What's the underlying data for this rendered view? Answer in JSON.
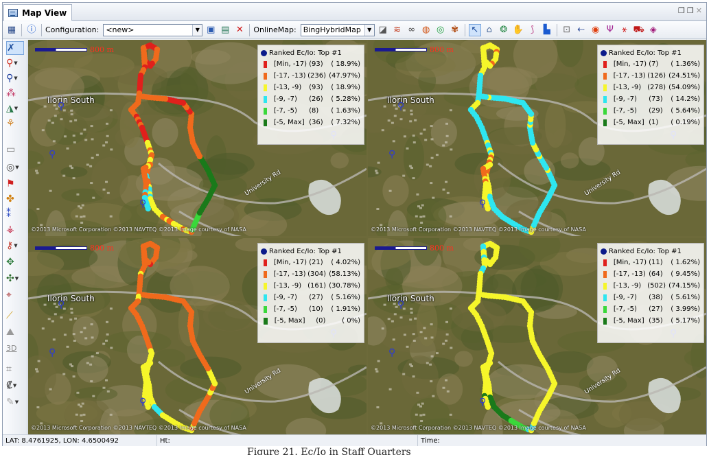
{
  "window": {
    "tab_label": "Map View"
  },
  "toolbar": {
    "configuration_label": "Configuration:",
    "configuration_value": "<new>",
    "onlinemap_label": "OnlineMap:",
    "onlinemap_value": "BingHybridMap"
  },
  "map": {
    "scale_text": "800 m",
    "town_label": "Ilorin South",
    "road_label": "University Rd",
    "credit_text": "©2013 Microsoft Corporation ©2013 NAVTEQ ©2013 Image courtesy of NASA",
    "legend_title": "Ranked Ec/Io: Top #1",
    "ranges": [
      "[Min, -17)",
      "[-17, -13)",
      "[-13, -9)",
      "[-9, -7)",
      "[-7, -5)",
      "[-5, Max]"
    ],
    "range_colors": [
      "#e0201c",
      "#f06a1c",
      "#f6f62a",
      "#2ee6f0",
      "#3ad83a",
      "#1a7a1a"
    ]
  },
  "panels": [
    {
      "counts": [
        "(93)",
        "(236)",
        "(93)",
        "(26)",
        "(8)",
        "(36)"
      ],
      "percents": [
        "( 18.9%)",
        "(47.97%)",
        "( 18.9%)",
        "( 5.28%)",
        "( 1.63%)",
        "( 7.32%)"
      ]
    },
    {
      "counts": [
        "(7)",
        "(126)",
        "(278)",
        "(73)",
        "(29)",
        "(1)"
      ],
      "percents": [
        "( 1.36%)",
        "(24.51%)",
        "(54.09%)",
        "( 14.2%)",
        "( 5.64%)",
        "( 0.19%)"
      ]
    },
    {
      "counts": [
        "(21)",
        "(304)",
        "(161)",
        "(27)",
        "(10)",
        "(0)"
      ],
      "percents": [
        "( 4.02%)",
        "(58.13%)",
        "(30.78%)",
        "( 5.16%)",
        "( 1.91%)",
        "(   0%)"
      ]
    },
    {
      "counts": [
        "(11)",
        "(64)",
        "(502)",
        "(38)",
        "(27)",
        "(35)"
      ],
      "percents": [
        "( 1.62%)",
        "( 9.45%)",
        "(74.15%)",
        "( 5.61%)",
        "( 3.99%)",
        "( 5.17%)"
      ]
    }
  ],
  "statusbar": {
    "coords": "LAT: 8.4761925, LON: 4.6500492",
    "ht_label": "Ht:",
    "time_label": "Time:"
  },
  "caption": "Figure 21. Ec/Io in Staff Quarters"
}
